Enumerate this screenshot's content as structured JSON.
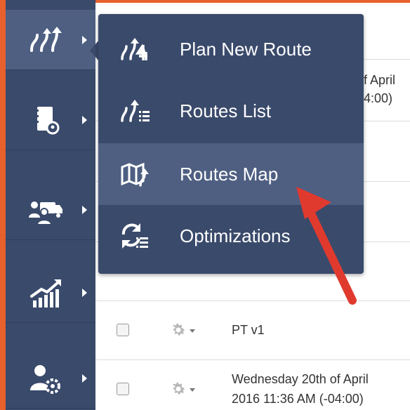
{
  "sidebar": {
    "items": [
      {
        "icon": "route-icon",
        "active": true
      },
      {
        "icon": "address-book-icon",
        "active": false
      },
      {
        "icon": "team-vehicle-icon",
        "active": false
      },
      {
        "icon": "analytics-chart-icon",
        "active": false
      },
      {
        "icon": "user-settings-icon",
        "active": false
      }
    ]
  },
  "flyout": {
    "items": [
      {
        "label": "Plan New Route",
        "icon": "plan-route-icon"
      },
      {
        "label": "Routes List",
        "icon": "routes-list-icon"
      },
      {
        "label": "Routes Map",
        "icon": "routes-map-icon",
        "hover": true
      },
      {
        "label": "Optimizations",
        "icon": "optimizations-icon"
      }
    ]
  },
  "table": {
    "rows": [
      {
        "text_line1": "f April",
        "text_line2": "4:00)"
      },
      {
        "text_line1": "PT v1"
      },
      {
        "text_line1": "Wednesday 20th of April",
        "text_line2": "2016 11:36 AM (-04:00)"
      }
    ]
  },
  "colors": {
    "frame": "#e8602c",
    "sidebar": "#3a4a6b",
    "sidebar_active": "#4e5f82",
    "arrow": "#e03a2f"
  }
}
